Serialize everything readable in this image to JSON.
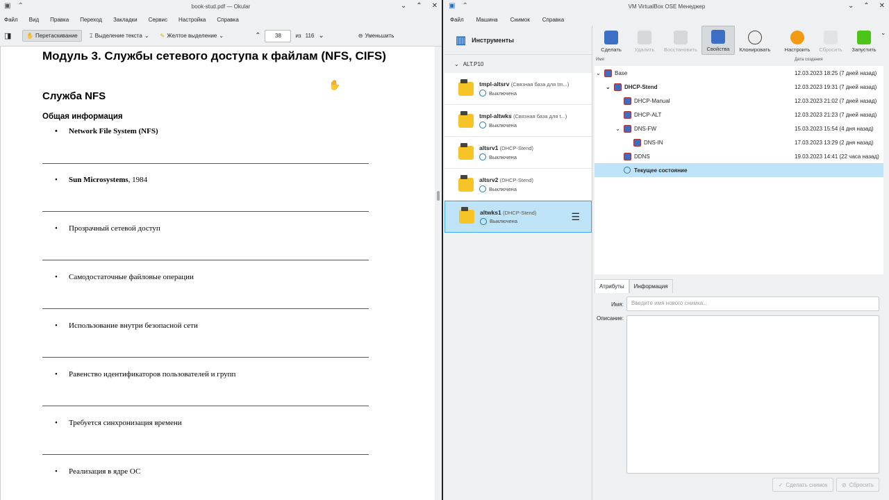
{
  "okular": {
    "title": "book-stud.pdf — Okular",
    "menu": [
      "Файл",
      "Вид",
      "Правка",
      "Переход",
      "Закладки",
      "Сервис",
      "Настройка",
      "Справка"
    ],
    "toolbar": {
      "drag": "Перетаскивание",
      "select_text": "Выделение текста",
      "yellow": "Желтое выделение",
      "page": "38",
      "of": "из",
      "total": "116",
      "zoom_out": "Уменьшить"
    },
    "doc": {
      "h1": "Модуль 3. Службы сетевого доступа к файлам (NFS, CIFS)",
      "h2": "Служба NFS",
      "h3": "Общая информация",
      "b1": "Network File System (NFS)",
      "b2_bold": "Sun Microsystems",
      "b2_rest": ", 1984",
      "b3": "Прозрачный сетевой доступ",
      "b4": "Самодостаточные файловые операции",
      "b5": "Использование внутри безопасной сети",
      "b6": "Равенство идентификаторов пользователей и групп",
      "b7": "Требуется синхронизация времени",
      "b8": "Реализация в ядре ОС"
    }
  },
  "vbox": {
    "title": "VM VirtualBox OSE Менеджер",
    "menu": [
      "Файл",
      "Машина",
      "Снимок",
      "Справка"
    ],
    "tools": "Инструменты",
    "group": "ALT.P10",
    "off": "Выключена",
    "vms": [
      {
        "name": "tmpl-altsrv",
        "sub": "(Связная база для tm...)"
      },
      {
        "name": "tmpl-altwks",
        "sub": "(Связная база для t...)"
      },
      {
        "name": "altsrv1",
        "sub": "(DHCP-Stend)"
      },
      {
        "name": "altsrv2",
        "sub": "(DHCP-Stend)"
      },
      {
        "name": "altwks1",
        "sub": "(DHCP-Stend)"
      }
    ],
    "buttons": {
      "take": "Сделать",
      "delete": "Удалить",
      "restore": "Восстановить",
      "props": "Свойства",
      "clone": "Клонировать",
      "settings": "Настроить",
      "discard": "Сбросить",
      "start": "Запустить"
    },
    "col_name": "Имя",
    "col_date": "Дата создания",
    "snapshots": [
      {
        "name": "Base",
        "date": "12.03.2023 18:25 (7 дней назад)"
      },
      {
        "name": "DHCP-Stend",
        "date": "12.03.2023 19:31 (7 дней назад)"
      },
      {
        "name": "DHCP-Manual",
        "date": "12.03.2023 21:02 (7 дней назад)"
      },
      {
        "name": "DHCP-ALT",
        "date": "12.03.2023 21:23 (7 дней назад)"
      },
      {
        "name": "DNS-FW",
        "date": "15.03.2023 15:54 (4 дня назад)"
      },
      {
        "name": "DNS-IN",
        "date": "17.03.2023 13:29 (2 дня назад)"
      },
      {
        "name": "DDNS",
        "date": "19.03.2023 14:41 (22 часа назад)"
      }
    ],
    "current_state": "Текущее состояние",
    "tab_attr": "Атрибуты",
    "tab_info": "Информация",
    "name_label": "Имя:",
    "name_placeholder": "Введите имя нового снимка...",
    "desc_label": "Описание:",
    "btn_take_snap": "Сделать снимок",
    "btn_reset": "Сбросить"
  }
}
